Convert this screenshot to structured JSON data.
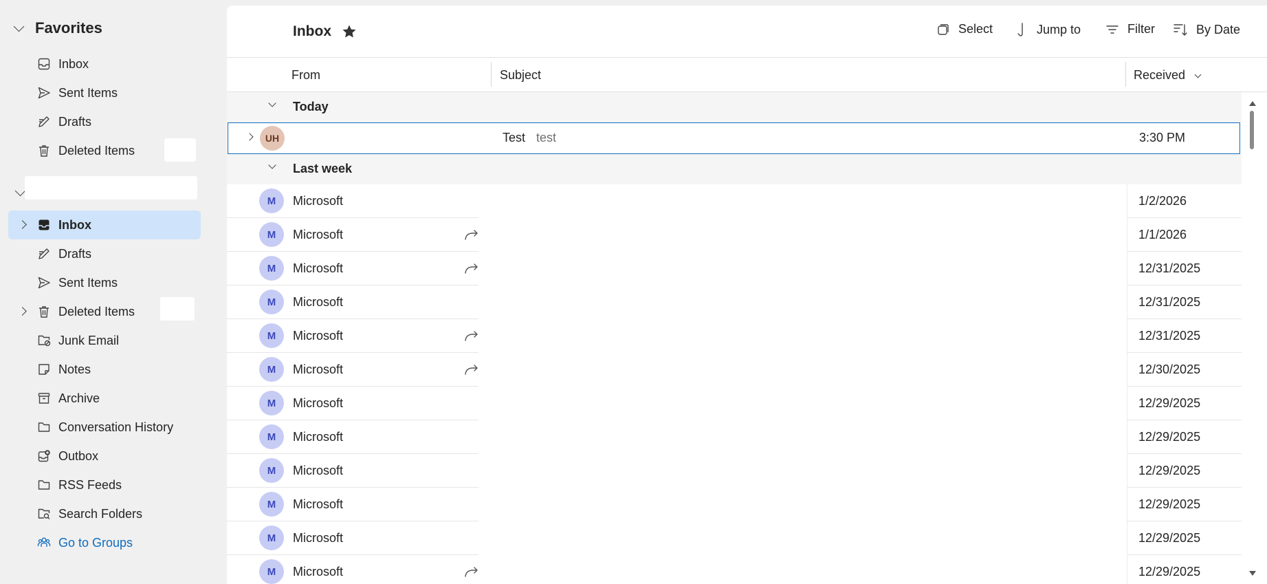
{
  "sidebar": {
    "favorites_label": "Favorites",
    "favorites": [
      {
        "label": "Inbox"
      },
      {
        "label": "Sent Items"
      },
      {
        "label": "Drafts"
      },
      {
        "label": "Deleted Items"
      }
    ],
    "account_folders": [
      {
        "label": "Inbox",
        "selected": true
      },
      {
        "label": "Drafts"
      },
      {
        "label": "Sent Items"
      },
      {
        "label": "Deleted Items"
      },
      {
        "label": "Junk Email"
      },
      {
        "label": "Notes"
      },
      {
        "label": "Archive"
      },
      {
        "label": "Conversation History"
      },
      {
        "label": "Outbox"
      },
      {
        "label": "RSS Feeds"
      },
      {
        "label": "Search Folders"
      }
    ],
    "groups_link": "Go to Groups"
  },
  "toolbar": {
    "title": "Inbox",
    "select_label": "Select",
    "jump_label": "Jump to",
    "filter_label": "Filter",
    "sort_label": "By Date"
  },
  "columns": {
    "from": "From",
    "subject": "Subject",
    "received": "Received"
  },
  "groups": {
    "today": "Today",
    "last_week": "Last week"
  },
  "today_message": {
    "avatar": "UH",
    "subject": "Test",
    "preview": "test",
    "received": "3:30 PM"
  },
  "messages": [
    {
      "avatar": "M",
      "from": "Microsoft",
      "received": "1/2/2026",
      "forwarded": false
    },
    {
      "avatar": "M",
      "from": "Microsoft",
      "received": "1/1/2026",
      "forwarded": true
    },
    {
      "avatar": "M",
      "from": "Microsoft",
      "received": "12/31/2025",
      "forwarded": true
    },
    {
      "avatar": "M",
      "from": "Microsoft",
      "received": "12/31/2025",
      "forwarded": false
    },
    {
      "avatar": "M",
      "from": "Microsoft",
      "received": "12/31/2025",
      "forwarded": true
    },
    {
      "avatar": "M",
      "from": "Microsoft",
      "received": "12/30/2025",
      "forwarded": true
    },
    {
      "avatar": "M",
      "from": "Microsoft",
      "received": "12/29/2025",
      "forwarded": false
    },
    {
      "avatar": "M",
      "from": "Microsoft",
      "received": "12/29/2025",
      "forwarded": false
    },
    {
      "avatar": "M",
      "from": "Microsoft",
      "received": "12/29/2025",
      "forwarded": false
    },
    {
      "avatar": "M",
      "from": "Microsoft",
      "received": "12/29/2025",
      "forwarded": false
    },
    {
      "avatar": "M",
      "from": "Microsoft",
      "received": "12/29/2025",
      "forwarded": false
    },
    {
      "avatar": "M",
      "from": "Microsoft",
      "received": "12/29/2025",
      "forwarded": true
    }
  ],
  "colors": {
    "accent": "#0f6cbd",
    "selected_folder_bg": "#cfe4fa",
    "avatar_m_bg": "#c7ccf5",
    "avatar_uh_bg": "#e4c4b4"
  }
}
